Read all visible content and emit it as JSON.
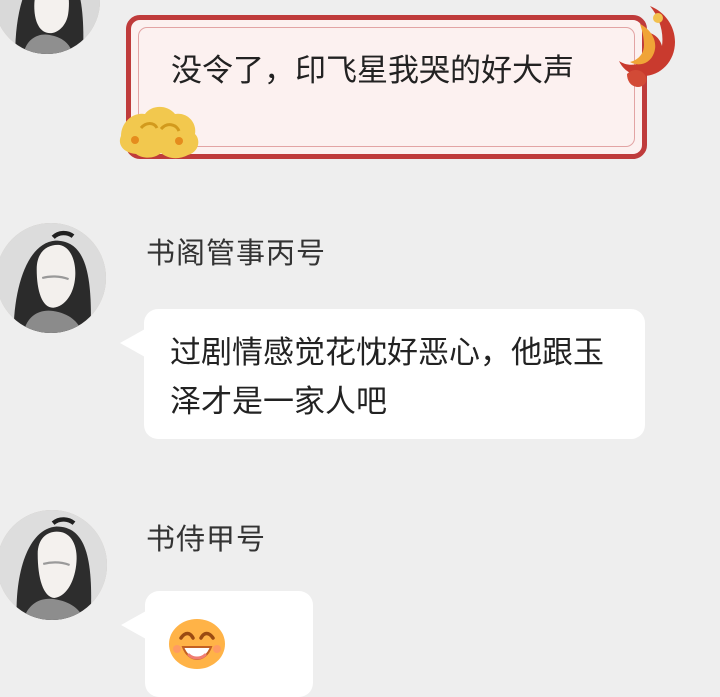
{
  "chat": {
    "messages": [
      {
        "text": "没令了，印飞星我哭的好大声"
      },
      {
        "sender": "书阁管事丙号",
        "text": "过剧情感觉花忱好恶心，他跟玉泽才是一家人吧"
      },
      {
        "sender": "书侍甲号",
        "content": "laughing-emoji-icon"
      }
    ]
  },
  "colors": {
    "background": "#eeeeee",
    "bubble": "#ffffff",
    "special_bubble_border": "#bf3b3b",
    "special_bubble_fill": "#fcf1f0",
    "text": "#222222",
    "name": "#333333",
    "emoji": "#ffb347"
  }
}
